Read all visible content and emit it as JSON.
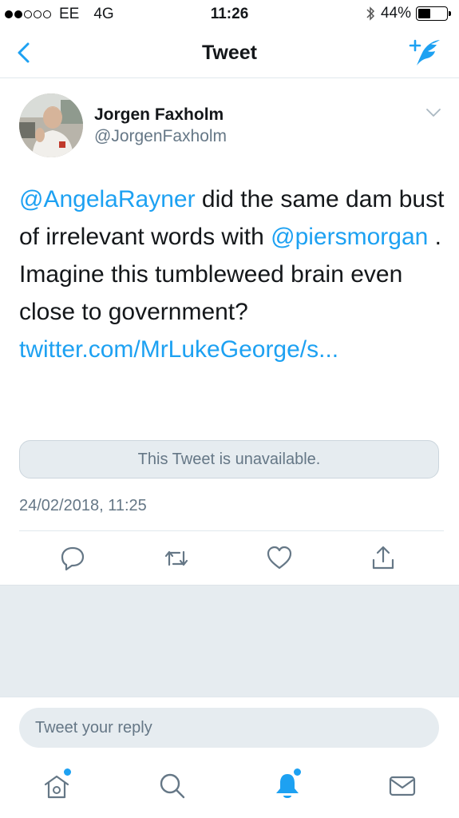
{
  "status_bar": {
    "carrier": "EE",
    "network": "4G",
    "time": "11:26",
    "battery": "44%",
    "battery_level": 0.44,
    "signal_bars": 2
  },
  "nav": {
    "title": "Tweet",
    "back_icon": "chevron-left-icon",
    "compose_icon": "compose-tweet-icon"
  },
  "tweet": {
    "author_name": "Jorgen Faxholm",
    "author_handle": "@JorgenFaxholm",
    "mention_1": "@AngelaRayner",
    "text_1": " did the same dam bust of irrelevant words with ",
    "mention_2": "@piersmorgan",
    "text_2": " .",
    "text_3": "Imagine this tumbleweed brain even close to government? ",
    "link": "twitter.com/MrLukeGeorge/s...",
    "quote_unavailable": "This Tweet is unavailable.",
    "timestamp": "24/02/2018, 11:25"
  },
  "actions": [
    "reply-icon",
    "retweet-icon",
    "like-icon",
    "share-icon"
  ],
  "reply": {
    "placeholder": "Tweet your reply"
  },
  "tabbar": [
    "home-icon",
    "search-icon",
    "notifications-icon",
    "messages-icon"
  ],
  "colors": {
    "accent": "#1da1f2",
    "muted": "#657786",
    "panel": "#e6ecf0"
  }
}
